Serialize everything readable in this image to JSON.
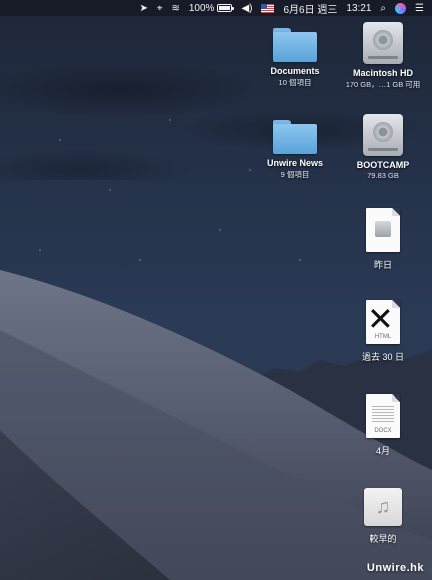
{
  "menubar": {
    "battery_percent": "100%",
    "battery_level": 1.0,
    "date": "6月6日 週三",
    "time": "13:21"
  },
  "icons": {
    "documents": {
      "name": "Documents",
      "sub": "10 個項目"
    },
    "macintosh_hd": {
      "name": "Macintosh HD",
      "sub": "170 GB，…1 GB 可用"
    },
    "unwire_news": {
      "name": "Unwire News",
      "sub": "9 個項目"
    },
    "bootcamp": {
      "name": "BOOTCAMP",
      "sub": "79.83 GB"
    },
    "doc_yesterday": {
      "label": "昨日"
    },
    "doc_html": {
      "label": "過去 30 日",
      "ext": "HTML"
    },
    "doc_docx": {
      "label": "4月",
      "ext": "DOCX"
    },
    "doc_music": {
      "label": "較早的"
    }
  },
  "watermark": "Unwire.hk",
  "colors": {
    "sky": "#243149",
    "dune": "#5d6479",
    "folder": "#6fb0e2"
  }
}
